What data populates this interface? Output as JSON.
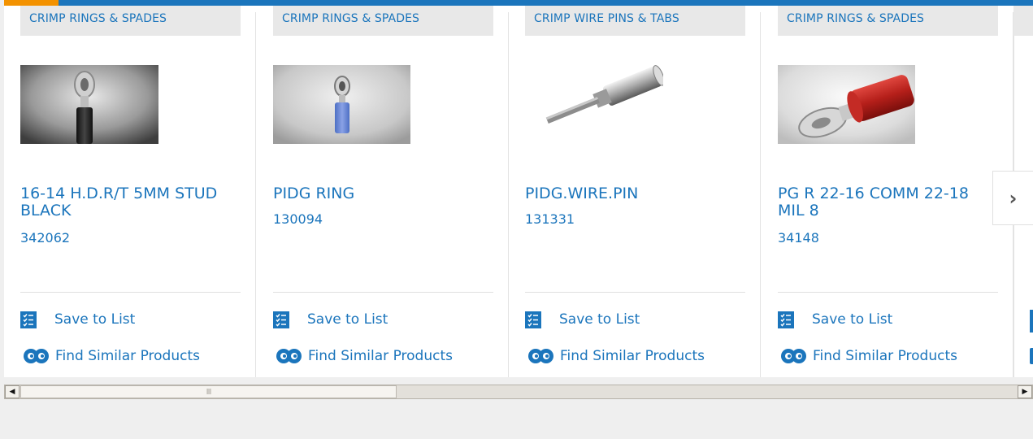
{
  "colors": {
    "accent": "#1b75bc",
    "highlight": "#f39200",
    "category_bg": "#e8e8e8"
  },
  "cards": [
    {
      "category": "CRIMP RINGS & SPADES",
      "title": "16-14 H.D.R/T 5MM STUD BLACK",
      "part_number": "342062",
      "save_label": "Save to List",
      "find_label": "Find Similar Products",
      "image": "black-ring-terminal"
    },
    {
      "category": "CRIMP RINGS & SPADES",
      "title": "PIDG RING",
      "part_number": "130094",
      "save_label": "Save to List",
      "find_label": "Find Similar Products",
      "image": "blue-ring-terminal"
    },
    {
      "category": "CRIMP WIRE PINS & TABS",
      "title": "PIDG.WIRE.PIN",
      "part_number": "131331",
      "save_label": "Save to List",
      "find_label": "Find Similar Products",
      "image": "wire-pin"
    },
    {
      "category": "CRIMP RINGS & SPADES",
      "title": "PG R 22-16 COMM 22-18 MIL 8",
      "part_number": "34148",
      "save_label": "Save to List",
      "find_label": "Find Similar Products",
      "image": "red-ring-terminal"
    }
  ],
  "carousel": {
    "next_icon": "chevron-right-icon",
    "next_glyph": "›"
  },
  "scrollbar": {
    "left_arrow": "◀",
    "right_arrow": "▶",
    "grip": "III"
  }
}
